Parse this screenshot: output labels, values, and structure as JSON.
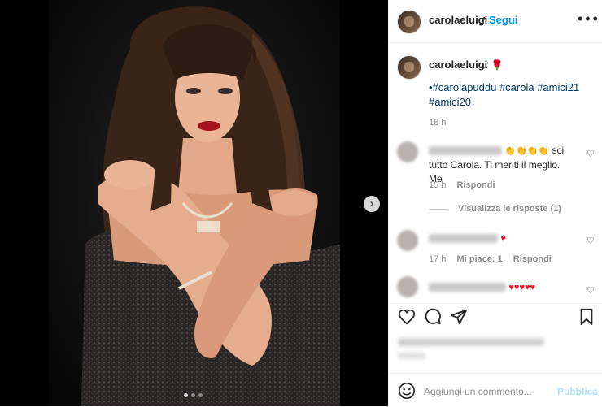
{
  "post": {
    "username": "carolaeluigi",
    "follow_label": "Segui",
    "caption_suffix": "..",
    "hashtags": "•#carolapuddu #carola #amici21 #amici20",
    "caption_time": "18 h"
  },
  "comments": [
    {
      "text_visible": "sci tutto Carola. Ti meriti il meglio. Me",
      "time": "15 h",
      "reply_label": "Rispondi",
      "view_replies": "Visualizza le risposte (1)"
    },
    {
      "time": "17 h",
      "likes_label": "Mi piace: 1",
      "reply_label": "Rispondi"
    },
    {
      "hearts": "♥♥♥♥♥"
    }
  ],
  "comment_box": {
    "placeholder": "Aggiungi un commento...",
    "publish_label": "Pubblica"
  },
  "icons": {
    "more": "more-options-icon",
    "like": "heart-icon",
    "comment": "comment-icon",
    "share": "share-icon",
    "save": "bookmark-icon",
    "emoji": "emoji-icon",
    "next": "chevron-right-icon"
  },
  "colors": {
    "link_blue": "#0095f6",
    "hashtag": "#00376b",
    "muted": "#8e8e8e",
    "publish_disabled": "#b2dffc"
  }
}
